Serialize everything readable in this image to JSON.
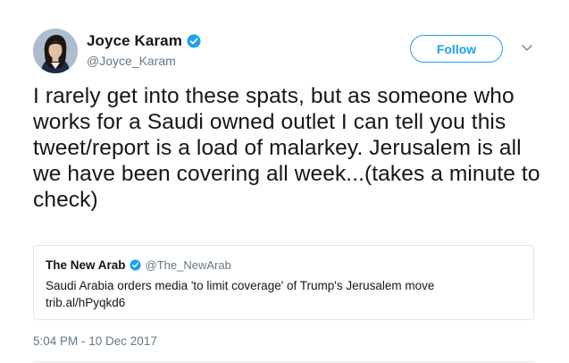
{
  "author": {
    "display_name": "Joyce Karam",
    "handle": "@Joyce_Karam",
    "verified_icon": "verified-badge"
  },
  "follow_button": {
    "label": "Follow"
  },
  "menu": {
    "icon": "chevron-down-icon"
  },
  "tweet": {
    "text": "I rarely get into these spats, but as someone who works for a Saudi owned outlet I can tell you this tweet/report is a load of malarkey. Jerusalem is all we have been covering all week...(takes a minute to check)",
    "timestamp": "5:04 PM - 10 Dec 2017"
  },
  "quoted_tweet": {
    "display_name": "The New Arab",
    "handle": "@The_NewArab",
    "text": "Saudi Arabia orders media 'to limit coverage' of Trump's Jerusalem move",
    "link": "trib.al/hPyqkd6"
  },
  "colors": {
    "accent": "#1da1f2",
    "secondary_text": "#657786",
    "border": "#e1e8ed"
  }
}
